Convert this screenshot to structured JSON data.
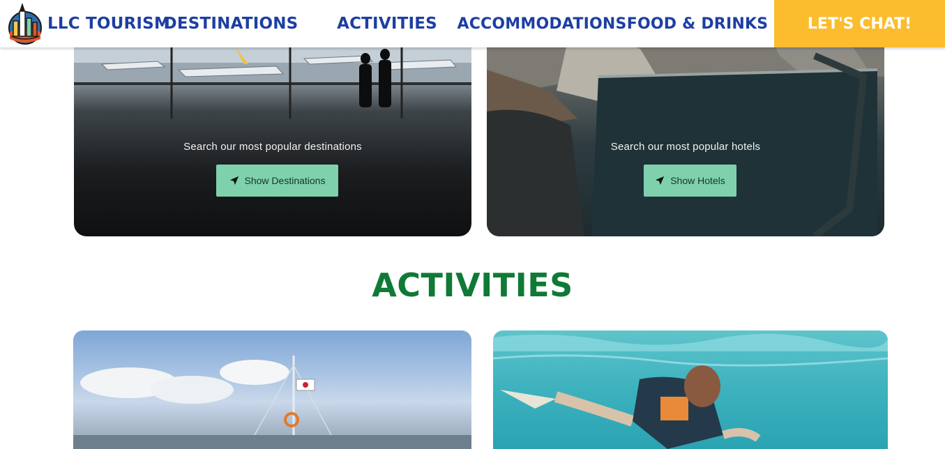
{
  "nav": {
    "brand": "LLC TOURISM",
    "links": [
      "DESTINATIONS",
      "ACTIVITIES",
      "ACCOMMODATIONS",
      "FOOD & DRINKS"
    ],
    "cta": "LET'S CHAT!"
  },
  "cards": [
    {
      "caption": "Search our most popular destinations",
      "button": "Show Destinations",
      "button_icon": "paper-plane-icon"
    },
    {
      "caption": "Search  our most popular hotels",
      "button": "Show Hotels",
      "button_icon": "paper-plane-icon"
    }
  ],
  "sections": {
    "activities_title": "ACTIVITIES"
  },
  "colors": {
    "nav_text": "#1d3fa3",
    "cta_bg": "#fbbc2e",
    "button_bg": "#7fd1ae",
    "section_title": "#0f7a36"
  }
}
